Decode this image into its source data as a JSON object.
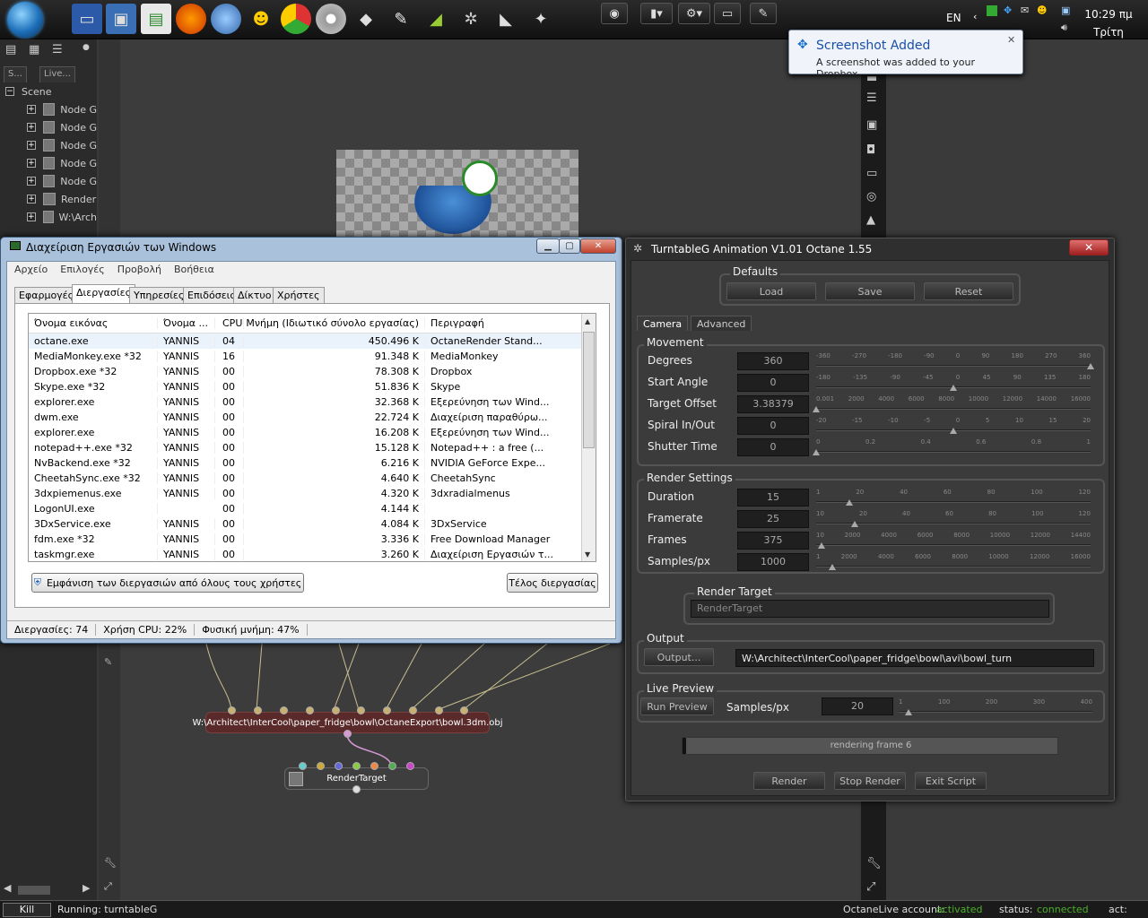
{
  "taskbar": {
    "lang": "EN",
    "time": "10:29 πμ",
    "day": "Τρίτη"
  },
  "popup": {
    "title": "Screenshot Added",
    "message": "A screenshot was added to your Dropbox."
  },
  "left_panel": {
    "tab1": "S...",
    "tab2": "Live...",
    "tree": [
      {
        "label": "Scene",
        "expanded": true
      },
      {
        "label": "Node G",
        "icon": "node-graph-icon"
      },
      {
        "label": "Node G",
        "icon": "node-graph-icon"
      },
      {
        "label": "Node G",
        "icon": "node-graph-icon"
      },
      {
        "label": "Node G",
        "icon": "node-graph-icon"
      },
      {
        "label": "Node G",
        "icon": "node-graph-icon"
      },
      {
        "label": "Render",
        "icon": "render-target-icon"
      },
      {
        "label": "W:\\Arch",
        "icon": "mesh-icon"
      }
    ]
  },
  "node_graph": {
    "obj_node": "W:\\Architect\\InterCool\\paper_fridge\\bowl\\OctaneExport\\bowl.3dm.obj",
    "render_target_node": "RenderTarget"
  },
  "bottombar": {
    "kill": "Kill",
    "running": "Running: turntableG",
    "octanelive_label": "OctaneLive account:",
    "octanelive_value": "activated",
    "status_label": "status:",
    "status_value": "connected",
    "act_label": "act:"
  },
  "taskmanager": {
    "title": "Διαχείριση Εργασιών των Windows",
    "menu": [
      "Αρχείο",
      "Επιλογές",
      "Προβολή",
      "Βοήθεια"
    ],
    "tabs": [
      "Εφαρμογές",
      "Διεργασίες",
      "Υπηρεσίες",
      "Επιδόσεις",
      "Δίκτυο",
      "Χρήστες"
    ],
    "selected_tab": "Διεργασίες",
    "columns": [
      "Όνομα εικόνας",
      "Όνομα ...",
      "CPU",
      "Μνήμη (Ιδιωτικό σύνολο εργασίας)",
      "Περιγραφή"
    ],
    "rows": [
      [
        "octane.exe",
        "YANNIS",
        "04",
        "450.496 K",
        "OctaneRender Stand..."
      ],
      [
        "MediaMonkey.exe *32",
        "YANNIS",
        "16",
        "91.348 K",
        "MediaMonkey"
      ],
      [
        "Dropbox.exe *32",
        "YANNIS",
        "00",
        "78.308 K",
        "Dropbox"
      ],
      [
        "Skype.exe *32",
        "YANNIS",
        "00",
        "51.836 K",
        "Skype"
      ],
      [
        "explorer.exe",
        "YANNIS",
        "00",
        "32.368 K",
        "Εξερεύνηση των Wind..."
      ],
      [
        "dwm.exe",
        "YANNIS",
        "00",
        "22.724 K",
        "Διαχείριση παραθύρω..."
      ],
      [
        "explorer.exe",
        "YANNIS",
        "00",
        "16.208 K",
        "Εξερεύνηση των Wind..."
      ],
      [
        "notepad++.exe *32",
        "YANNIS",
        "00",
        "15.128 K",
        "Notepad++ : a free (..."
      ],
      [
        "NvBackend.exe *32",
        "YANNIS",
        "00",
        "6.216 K",
        "NVIDIA GeForce Expe..."
      ],
      [
        "CheetahSync.exe *32",
        "YANNIS",
        "00",
        "4.640 K",
        "CheetahSync"
      ],
      [
        "3dxpiemenus.exe",
        "YANNIS",
        "00",
        "4.320 K",
        "3dxradialmenus"
      ],
      [
        "LogonUI.exe",
        "",
        "00",
        "4.144 K",
        ""
      ],
      [
        "3DxService.exe",
        "YANNIS",
        "00",
        "4.084 K",
        "3DxService"
      ],
      [
        "fdm.exe *32",
        "YANNIS",
        "00",
        "3.336 K",
        "Free Download Manager"
      ],
      [
        "taskmgr.exe",
        "YANNIS",
        "00",
        "3.260 K",
        "Διαχείριση Εργασιών τ..."
      ]
    ],
    "show_all_button": "Εμφάνιση των διεργασιών από όλους τους χρήστες",
    "end_process_button": "Τέλος διεργασίας",
    "status": {
      "processes": "Διεργασίες: 74",
      "cpu": "Χρήση CPU: 22%",
      "memory": "Φυσική μνήμη: 47%"
    }
  },
  "turntable": {
    "title": "TurntableG Animation V1.01 Octane 1.55",
    "defaults_label": "Defaults",
    "load": "Load",
    "save": "Save",
    "reset": "Reset",
    "tab_camera": "Camera",
    "tab_advanced": "Advanced",
    "movement_label": "Movement",
    "movement": [
      {
        "label": "Degrees",
        "value": "360",
        "ticks": [
          "-360",
          "-270",
          "-180",
          "-90",
          "0",
          "90",
          "180",
          "270",
          "360"
        ],
        "pos": 1.0
      },
      {
        "label": "Start Angle",
        "value": "0",
        "ticks": [
          "-180",
          "-135",
          "-90",
          "-45",
          "0",
          "45",
          "90",
          "135",
          "180"
        ],
        "pos": 0.5
      },
      {
        "label": "Target Offset",
        "value": "3.38379",
        "ticks": [
          "0.001",
          "2000",
          "4000",
          "6000",
          "8000",
          "10000",
          "12000",
          "14000",
          "16000"
        ],
        "pos": 0.0
      },
      {
        "label": "Spiral In/Out",
        "value": "0",
        "ticks": [
          "-20",
          "-15",
          "-10",
          "-5",
          "0",
          "5",
          "10",
          "15",
          "20"
        ],
        "pos": 0.5
      },
      {
        "label": "Shutter Time",
        "value": "0",
        "ticks": [
          "0",
          "0.2",
          "0.4",
          "0.6",
          "0.8",
          "1"
        ],
        "pos": 0.0
      }
    ],
    "render_settings_label": "Render Settings",
    "render_settings": [
      {
        "label": "Duration",
        "value": "15",
        "ticks": [
          "1",
          "20",
          "40",
          "60",
          "80",
          "100",
          "120"
        ],
        "pos": 0.12
      },
      {
        "label": "Framerate",
        "value": "25",
        "ticks": [
          "10",
          "20",
          "40",
          "60",
          "80",
          "100",
          "120"
        ],
        "pos": 0.14
      },
      {
        "label": "Frames",
        "value": "375",
        "ticks": [
          "10",
          "2000",
          "4000",
          "6000",
          "8000",
          "10000",
          "12000",
          "14400"
        ],
        "pos": 0.02
      },
      {
        "label": "Samples/px",
        "value": "1000",
        "ticks": [
          "1",
          "2000",
          "4000",
          "6000",
          "8000",
          "10000",
          "12000",
          "16000"
        ],
        "pos": 0.06
      }
    ],
    "render_target_label": "Render Target",
    "render_target_value": "RenderTarget",
    "output_label": "Output",
    "output_button": "Output...",
    "output_path": "W:\\Architect\\InterCool\\paper_fridge\\bowl\\avi\\bowl_turn",
    "live_preview_label": "Live Preview",
    "run_preview": "Run Preview",
    "lp_samples_label": "Samples/px",
    "lp_samples_value": "20",
    "lp_ticks": [
      "1",
      "100",
      "200",
      "300",
      "400"
    ],
    "lp_pos": 0.05,
    "progress_text": "rendering frame 6",
    "progress_fraction": 0.01,
    "render": "Render",
    "stop_render": "Stop Render",
    "exit_script": "Exit Script"
  },
  "colors": {
    "activated": "#4caf2a",
    "connected": "#4caf2a",
    "obj_node": "#5a2a2a"
  }
}
